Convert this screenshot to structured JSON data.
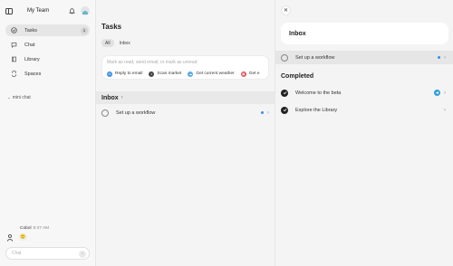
{
  "sidebar": {
    "team_name": "My Team",
    "items": [
      {
        "label": "Tasks",
        "count": "1",
        "icon": "check-circle-icon"
      },
      {
        "label": "Chat",
        "icon": "chat-bubble-icon"
      },
      {
        "label": "Library",
        "icon": "book-icon"
      },
      {
        "label": "Spaces",
        "icon": "spaces-icon"
      }
    ],
    "section_label": "mini chat",
    "chat": {
      "author": "Cobol",
      "time": "9:37 AM",
      "reaction": "🙂"
    },
    "chat_input_placeholder": "Chat"
  },
  "main": {
    "title": "Tasks",
    "tabs": [
      {
        "label": "All"
      },
      {
        "label": "Inbox"
      }
    ],
    "command_placeholder": "Mark as read, send email, or mark as unread",
    "quick_actions": [
      {
        "label": "Reply to email",
        "color": "#3a8ee6"
      },
      {
        "label": "Scan market",
        "color": "#444444"
      },
      {
        "label": "Get current weather",
        "color": "#5aa7e8"
      },
      {
        "label": "Get e",
        "color": "#e24d4d"
      }
    ],
    "inbox_title": "Inbox",
    "tasks": [
      {
        "label": "Set up a workflow",
        "unread": true
      }
    ]
  },
  "detail": {
    "close_icon": "close-icon",
    "header": "Inbox",
    "inbox_items": [
      {
        "label": "Set up a workflow"
      }
    ],
    "completed_title": "Completed",
    "completed_items": [
      {
        "label": "Welcome to the beta",
        "icon": "telegram-icon"
      },
      {
        "label": "Explore the Library"
      }
    ]
  },
  "colors": {
    "accent": "#3a8ee6",
    "sidebar_bg": "#f7f7f7",
    "main_bg": "#f4f4f4"
  }
}
